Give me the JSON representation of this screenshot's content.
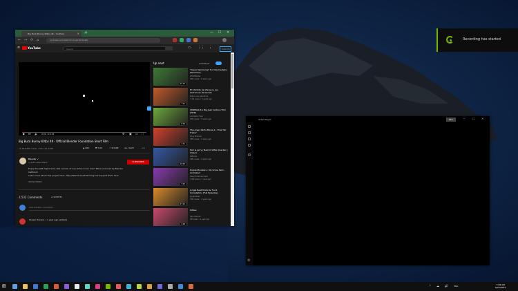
{
  "browser": {
    "tab_title": "Big Buck Bunny 60fps 4K - YouTube",
    "url": "youtube.com/watch?v=aqz-KE-bpKQ",
    "window_controls": [
      "—",
      "☐",
      "✕"
    ],
    "new_tab": "+",
    "nav_icons": [
      "←",
      "→",
      "⟳",
      "⌂"
    ]
  },
  "youtube": {
    "logo_text": "YouTube",
    "search_placeholder": "Search",
    "sign_in": "SIGN IN",
    "video_title": "Big Buck Bunny 60fps 4K - Official Blender Foundation Short Film",
    "video_meta": "11,023,876 views • Nov 10, 2014",
    "actions": [
      "▲ 96K",
      "▼ 3.6K",
      "↗ SHARE",
      "≡+ SAVE",
      "•••"
    ],
    "player_time": "0:00 / 10:34",
    "channel_name": "Blender ✓",
    "channel_subs": "1.41M subscribers",
    "subscribe": "SUBSCRIBE",
    "description": [
      "Enjoy this with high frame rate version of one of the iconic short films produced by Blender",
      "Institute!",
      "Learn more about this project here: http://bbb3d.renderfarming.net  Support them here",
      "SHOW MORE"
    ],
    "comments_count": "2,532 Comments",
    "sort_by": "≡ SORT BY",
    "add_comment": "Add a public comment...",
    "first_comment_author": "Shawn Herrera • 1 year ago (edited)",
    "up_next": "Up next",
    "autoplay": "AUTOPLAY",
    "recommendations": [
      {
        "title": "\"Clean Swimming\" for Intermediate Swimmers",
        "channel": "LEGOMaster",
        "views": "19M views • 6 years ago",
        "duration": "10:14",
        "color": "#3d7a34"
      },
      {
        "title": "El Chichito de Chicas & Los Ladronnes de Canela",
        "channel": "Paleo-cine caricature",
        "views": "7.1M views • 3 years ago",
        "duration": "7:21",
        "color": "#c25a28"
      },
      {
        "title": "SHREKGUS x Big Jazz Cartoon Film (HDR)",
        "channel": "Animation Feel",
        "views": "11M views • 5 years ago",
        "duration": "8:39",
        "color": "#6da83b"
      },
      {
        "title": "The Angry Birds Movie 2 - Final 'No Trailer'",
        "channel": "Sony Pictures",
        "views": "24M views • 2 years ago",
        "duration": "2:31",
        "color": "#d4412c"
      },
      {
        "title": "Tom & Jerry | Best of Little Quacker | Classic",
        "channel": "WB Kids",
        "views": "35M views • 2 years ago",
        "duration": "10:05",
        "color": "#3359a8"
      },
      {
        "title": "Purple Monsters - My Uncle Sam - Animated",
        "channel": "Sealy Entertainment",
        "views": "2.9M views • 1 year ago",
        "duration": "3:23",
        "color": "#8a3ab0"
      },
      {
        "title": "Jungle Beat Munki & Trunk Compilation (Full Episodes)",
        "channel": "Jungle Beat",
        "views": "31M views • 4 years ago",
        "duration": "47:42",
        "color": "#d88a2a"
      },
      {
        "title": "Kitties",
        "channel": "Cat Channel",
        "views": "4M views • 1 year ago",
        "duration": "2:08",
        "color": "#c94a6a"
      }
    ]
  },
  "notification": {
    "text": "Recording has started",
    "accent_color": "#76b900"
  },
  "player_window": {
    "title": "Video Player",
    "button": "REC",
    "controls": [
      "—",
      "☐",
      "✕"
    ]
  },
  "taskbar": {
    "start": "⊞",
    "tray_icons": [
      "^",
      "☁",
      "🔊",
      "ENG"
    ],
    "time": "7:08 AM",
    "date": "6/22/2021",
    "app_colors": [
      "#5aa0e8",
      "#e8c25a",
      "#3c78d8",
      "#2f9e5b",
      "#d85a3c",
      "#8a5ad8",
      "#e8e8e8",
      "#5ad8c8",
      "#d83c8a",
      "#76b900",
      "#e85a5a",
      "#3cb4d8",
      "#b4d83c",
      "#d8a03c",
      "#6a6ad8",
      "#aaaaaa",
      "#3c8ad8",
      "#d86a3c"
    ]
  }
}
